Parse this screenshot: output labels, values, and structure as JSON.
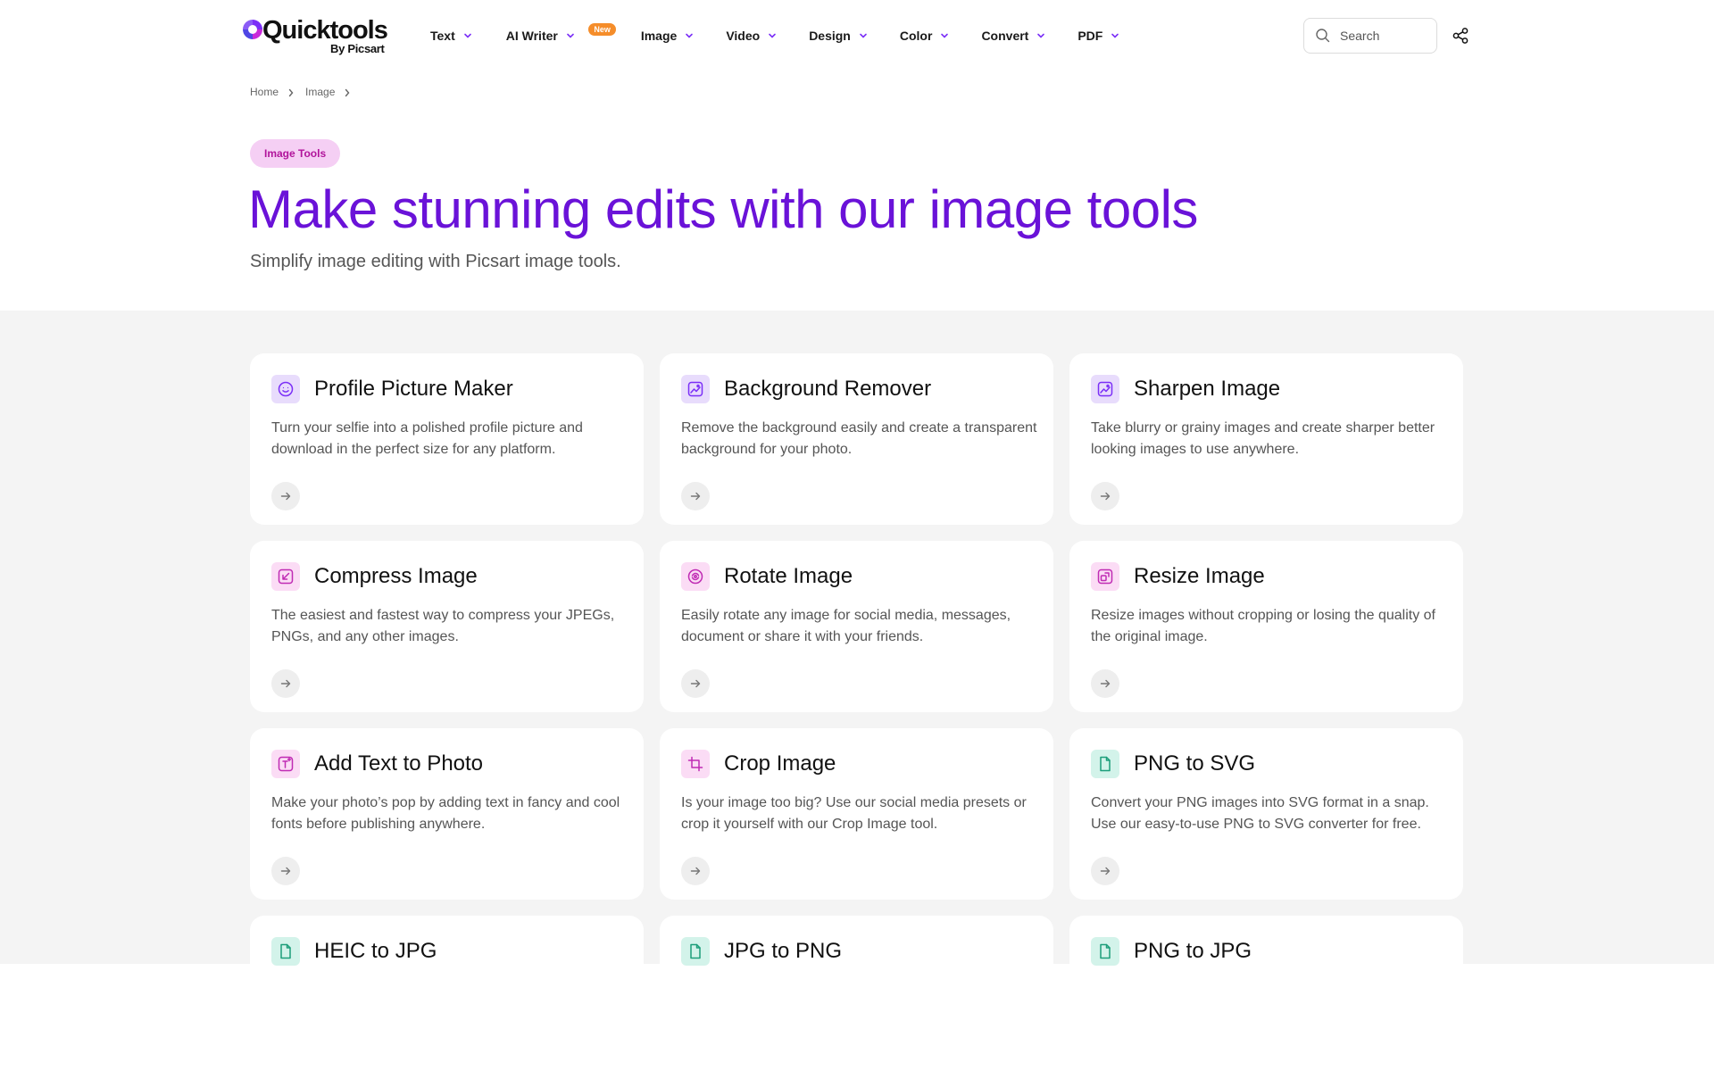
{
  "brand": {
    "title": "Quicktools",
    "subtitle": "By Picsart"
  },
  "nav": {
    "items": [
      {
        "label": "Text"
      },
      {
        "label": "AI Writer",
        "badge": "New"
      },
      {
        "label": "Image"
      },
      {
        "label": "Video"
      },
      {
        "label": "Design"
      },
      {
        "label": "Color"
      },
      {
        "label": "Convert"
      },
      {
        "label": "PDF"
      }
    ]
  },
  "search": {
    "placeholder": "Search"
  },
  "breadcrumb": {
    "items": [
      "Home",
      "Image"
    ]
  },
  "hero": {
    "pill": "Image Tools",
    "title": "Make stunning edits with our image tools",
    "subtitle": "Simplify image editing with Picsart image tools."
  },
  "colors": {
    "accent": "#6a12d8",
    "pill_bg": "#f5cff4",
    "pill_text": "#b1149b",
    "badge": "#f58d2a"
  },
  "tools": [
    {
      "title": "Profile Picture Maker",
      "desc": "Turn your selfie into a polished profile picture and download in the perfect size for any platform.",
      "icon": "smile-icon",
      "icon_bg": "#e8dcfc",
      "icon_color": "#7b2ff7"
    },
    {
      "title": "Background Remover",
      "desc": "Remove the background easily and create a transparent background for your photo.",
      "icon": "image-icon",
      "icon_bg": "#e8dcfc",
      "icon_color": "#7b2ff7"
    },
    {
      "title": "Sharpen Image",
      "desc": "Take blurry or grainy images and create sharper better looking images to use anywhere.",
      "icon": "image-icon",
      "icon_bg": "#e8dcfc",
      "icon_color": "#7b2ff7"
    },
    {
      "title": "Compress Image",
      "desc": "The easiest and fastest way to compress your JPEGs, PNGs, and any other images.",
      "icon": "compress-icon",
      "icon_bg": "#fbdcf5",
      "icon_color": "#c02bb4"
    },
    {
      "title": "Rotate Image",
      "desc": "Easily rotate any image for social media, messages, document or share it with your friends.",
      "icon": "rotate-icon",
      "icon_bg": "#fbdcf5",
      "icon_color": "#c02bb4"
    },
    {
      "title": "Resize Image",
      "desc": "Resize images without cropping or losing the quality of the original image.",
      "icon": "resize-icon",
      "icon_bg": "#fbdcf5",
      "icon_color": "#c02bb4"
    },
    {
      "title": "Add Text to Photo",
      "desc": "Make your photo’s pop by adding text in fancy and cool fonts before publishing anywhere.",
      "icon": "add-text-icon",
      "icon_bg": "#fbdcf5",
      "icon_color": "#c02bb4"
    },
    {
      "title": "Crop Image",
      "desc": "Is your image too big? Use our social media presets or crop it yourself with our Crop Image tool.",
      "icon": "crop-icon",
      "icon_bg": "#fbdcf5",
      "icon_color": "#c02bb4"
    },
    {
      "title": "PNG to SVG",
      "desc": "Convert your PNG images into SVG format in a snap. Use our easy-to-use PNG to SVG converter for free.",
      "icon": "file-icon",
      "icon_bg": "#d3f3ea",
      "icon_color": "#1c9e7a"
    },
    {
      "title": "HEIC to JPG",
      "desc": "",
      "icon": "file-icon",
      "icon_bg": "#d3f3ea",
      "icon_color": "#1c9e7a"
    },
    {
      "title": "JPG to PNG",
      "desc": "",
      "icon": "file-icon",
      "icon_bg": "#d3f3ea",
      "icon_color": "#1c9e7a"
    },
    {
      "title": "PNG to JPG",
      "desc": "",
      "icon": "file-icon",
      "icon_bg": "#d3f3ea",
      "icon_color": "#1c9e7a"
    }
  ]
}
